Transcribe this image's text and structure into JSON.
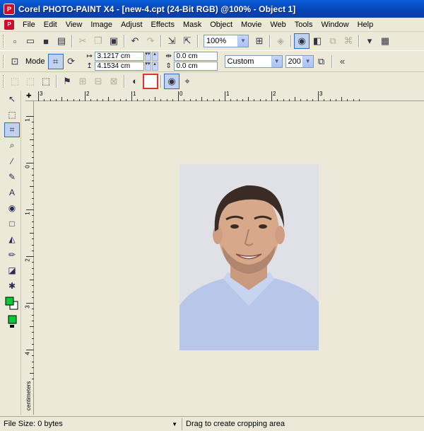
{
  "window": {
    "title": "Corel PHOTO-PAINT X4 - [new-4.cpt (24-Bit RGB) @100% - Object 1]",
    "app_icon_text": "P",
    "doc_icon_text": "P"
  },
  "menu": [
    "File",
    "Edit",
    "View",
    "Image",
    "Adjust",
    "Effects",
    "Mask",
    "Object",
    "Movie",
    "Web",
    "Tools",
    "Window",
    "Help"
  ],
  "standard_toolbar": {
    "zoom_value": "100%"
  },
  "property_bar": {
    "mode_label": "Mode",
    "width_value": "3.1217 cm",
    "height_value": "4.1534 cm",
    "x_value": "0.0 cm",
    "y_value": "0.0 cm",
    "preset_value": "Custom",
    "resolution_value": "200"
  },
  "rulers": {
    "horizontal_labels": [
      "3",
      "2",
      "1",
      "0",
      "1",
      "2",
      "3"
    ],
    "vertical_labels": [
      "1",
      "0",
      "1",
      "2",
      "3",
      "4"
    ],
    "unit": "centimeters"
  },
  "status": {
    "file_size": "File Size: 0 bytes",
    "hint": "Drag to create cropping area"
  },
  "colors": {
    "foreground": "#00cc33",
    "background": "#ffffff",
    "fill": "#00cc33"
  }
}
